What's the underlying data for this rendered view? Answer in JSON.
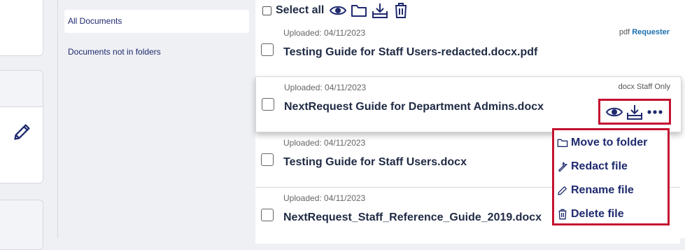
{
  "folders": {
    "items": [
      {
        "label": "All Documents",
        "active": true
      },
      {
        "label": "Documents not in folders",
        "active": false
      }
    ]
  },
  "toolbar": {
    "select_all_label": "Select all",
    "icons": [
      "eye-icon",
      "folder-icon",
      "download-icon",
      "trash-icon"
    ]
  },
  "documents": [
    {
      "uploaded": "Uploaded: 04/11/2023",
      "name": "Testing Guide for Staff Users-redacted.docx.pdf",
      "type": "pdf",
      "visibility": "Requester"
    },
    {
      "uploaded": "Uploaded: 04/11/2023",
      "name": "NextRequest Guide for Department Admins.docx",
      "type": "docx",
      "visibility": "Staff Only"
    },
    {
      "uploaded": "Uploaded: 04/11/2023",
      "name": "Testing Guide for Staff Users.docx"
    },
    {
      "uploaded": "Uploaded: 04/11/2023",
      "name": "NextRequest_Staff_Reference_Guide_2019.docx"
    }
  ],
  "actions_menu": {
    "items": [
      {
        "label": "Move to folder",
        "icon": "folder-icon"
      },
      {
        "label": "Redact file",
        "icon": "wrench-icon"
      },
      {
        "label": "Rename file",
        "icon": "pencil-icon"
      },
      {
        "label": "Delete file",
        "icon": "trash-icon"
      }
    ]
  },
  "colors": {
    "accent": "#1f2a6e",
    "link": "#1a6fb0",
    "highlight": "#c41230",
    "background": "#eef0f4"
  }
}
